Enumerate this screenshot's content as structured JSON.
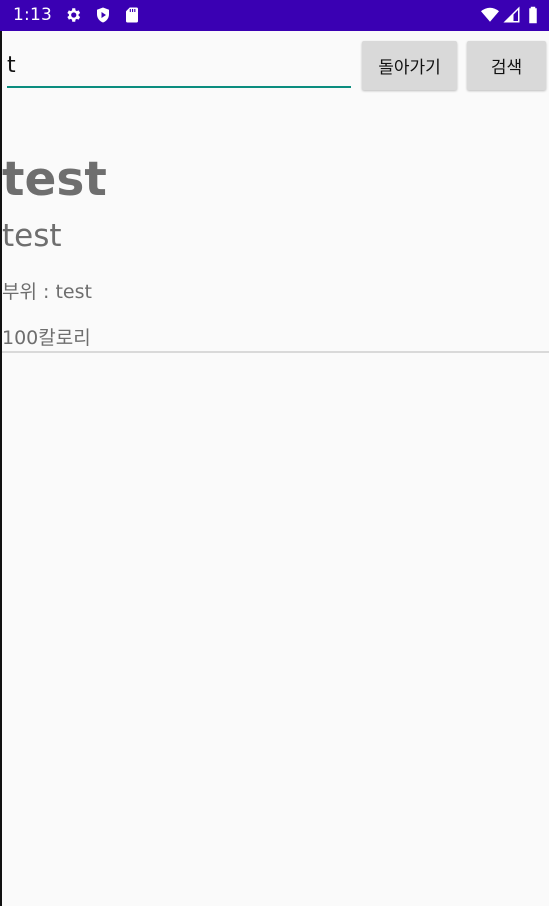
{
  "status_bar": {
    "time": "1:13",
    "icons": [
      "gear-icon",
      "play-shield-icon",
      "sd-card-icon",
      "wifi-icon",
      "signal-icon",
      "battery-icon"
    ],
    "background_color": "#3a00b3"
  },
  "search": {
    "value": "t",
    "underline_color": "#0b8d7f"
  },
  "buttons": {
    "back_label": "돌아가기",
    "search_label": "검색"
  },
  "result": {
    "title": "test",
    "subtitle": "test",
    "body_part": "부위 : test",
    "calories": "100칼로리"
  }
}
